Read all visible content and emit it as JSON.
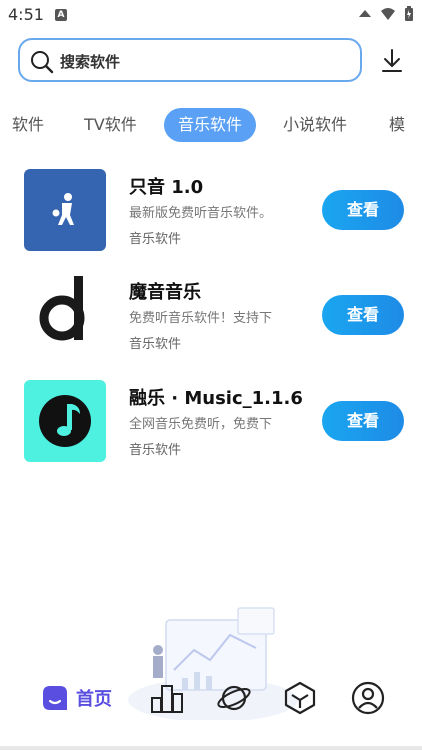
{
  "status": {
    "time": "4:51",
    "a_badge": "A"
  },
  "search": {
    "placeholder": "搜索软件"
  },
  "tabs": [
    {
      "label": "软件"
    },
    {
      "label": "TV软件"
    },
    {
      "label": "音乐软件",
      "active": true
    },
    {
      "label": "小说软件"
    },
    {
      "label": "模"
    }
  ],
  "apps": [
    {
      "title": "只音 1.0",
      "desc": "最新版免费听音乐软件。",
      "category": "音乐软件",
      "button": "查看",
      "icon": "basketball-player-icon"
    },
    {
      "title": "魔音音乐",
      "desc": "免费听音乐软件！支持下",
      "category": "音乐软件",
      "button": "查看",
      "icon": "letter-d-icon"
    },
    {
      "title": "融乐 · Music_1.1.6",
      "desc": "全网音乐免费听，免费下",
      "category": "音乐软件",
      "button": "查看",
      "icon": "music-note-icon"
    }
  ],
  "nav": {
    "home_label": "首页"
  },
  "colors": {
    "accent": "#5aa0f4",
    "button": "#1e8be6",
    "nav_active": "#5a4ee0"
  }
}
